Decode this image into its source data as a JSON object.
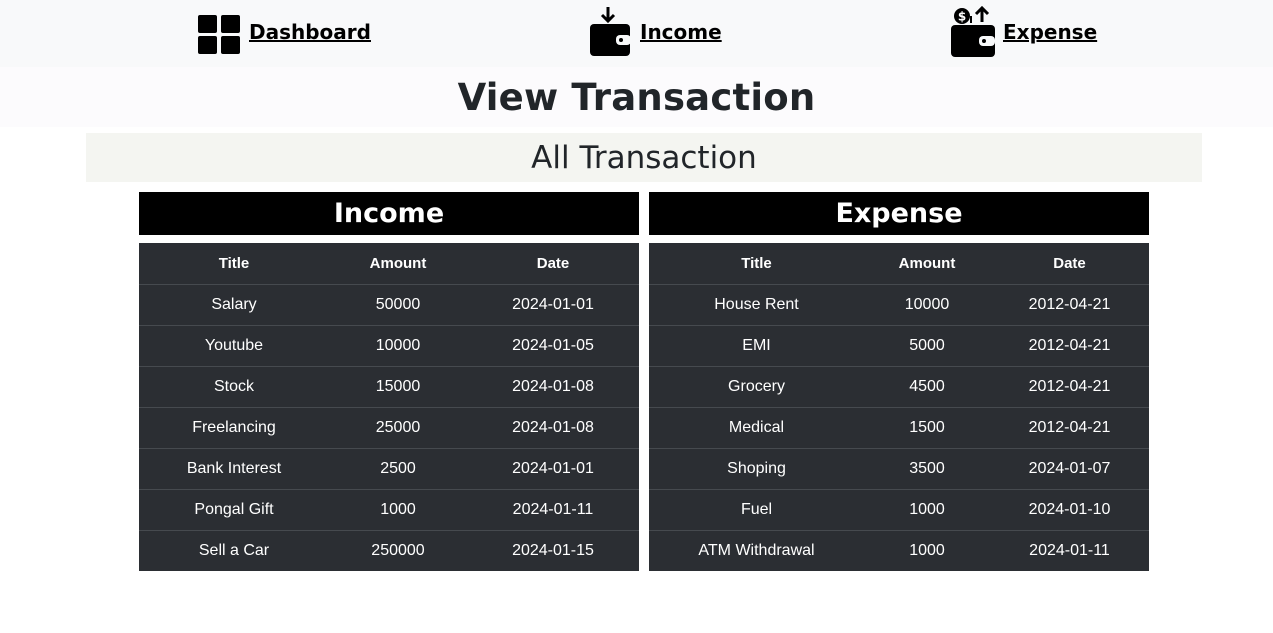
{
  "nav": {
    "items": [
      {
        "label": "Dashboard",
        "icon": "dashboard-grid-icon"
      },
      {
        "label": "Income",
        "icon": "wallet-in-icon"
      },
      {
        "label": "Expense",
        "icon": "wallet-out-icon"
      }
    ]
  },
  "page": {
    "title": "View Transaction",
    "subtitle": "All Transaction"
  },
  "income": {
    "heading": "Income",
    "columns": [
      "Title",
      "Amount",
      "Date"
    ],
    "rows": [
      {
        "title": "Salary",
        "amount": "50000",
        "date": "2024-01-01"
      },
      {
        "title": "Youtube",
        "amount": "10000",
        "date": "2024-01-05"
      },
      {
        "title": "Stock",
        "amount": "15000",
        "date": "2024-01-08"
      },
      {
        "title": "Freelancing",
        "amount": "25000",
        "date": "2024-01-08"
      },
      {
        "title": "Bank Interest",
        "amount": "2500",
        "date": "2024-01-01"
      },
      {
        "title": "Pongal Gift",
        "amount": "1000",
        "date": "2024-01-11"
      },
      {
        "title": "Sell a Car",
        "amount": "250000",
        "date": "2024-01-15"
      }
    ]
  },
  "expense": {
    "heading": "Expense",
    "columns": [
      "Title",
      "Amount",
      "Date"
    ],
    "rows": [
      {
        "title": "House Rent",
        "amount": "10000",
        "date": "2012-04-21"
      },
      {
        "title": "EMI",
        "amount": "5000",
        "date": "2012-04-21"
      },
      {
        "title": "Grocery",
        "amount": "4500",
        "date": "2012-04-21"
      },
      {
        "title": "Medical",
        "amount": "1500",
        "date": "2012-04-21"
      },
      {
        "title": "Shoping",
        "amount": "3500",
        "date": "2024-01-07"
      },
      {
        "title": "Fuel",
        "amount": "1000",
        "date": "2024-01-10"
      },
      {
        "title": "ATM Withdrawal",
        "amount": "1000",
        "date": "2024-01-11"
      }
    ]
  },
  "colors": {
    "navbar_bg": "#f8f9fa",
    "table_bg": "#2b2e33",
    "panel_head_bg": "#000000"
  }
}
